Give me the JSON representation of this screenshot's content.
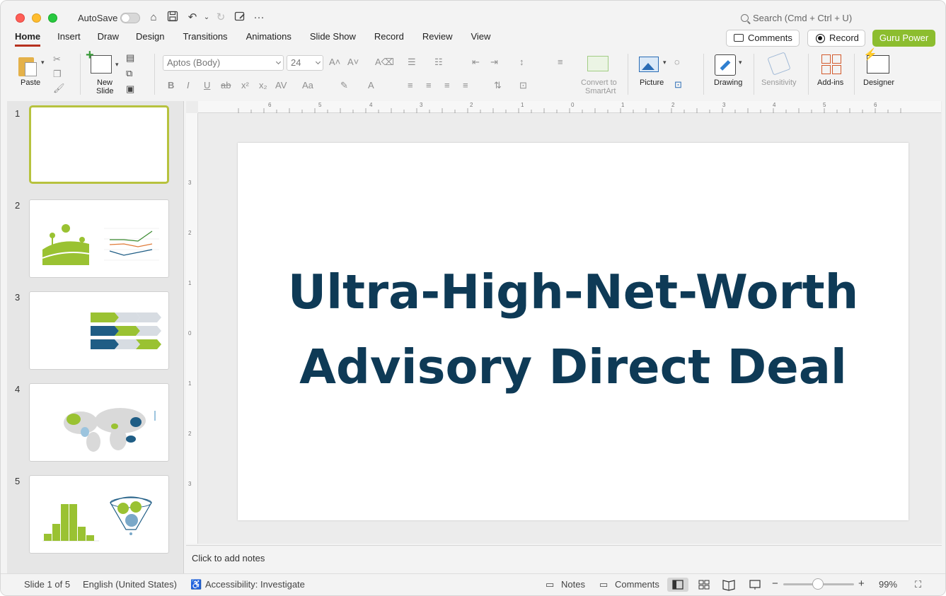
{
  "titlebar": {
    "autosave_label": "AutoSave",
    "search_placeholder": "Search (Cmd + Ctrl + U)"
  },
  "tabs": [
    {
      "label": "Home",
      "active": true
    },
    {
      "label": "Insert"
    },
    {
      "label": "Draw"
    },
    {
      "label": "Design"
    },
    {
      "label": "Transitions"
    },
    {
      "label": "Animations"
    },
    {
      "label": "Slide Show"
    },
    {
      "label": "Record"
    },
    {
      "label": "Review"
    },
    {
      "label": "View"
    }
  ],
  "header_buttons": {
    "comments": "Comments",
    "record": "Record",
    "guru": "Guru Power"
  },
  "ribbon": {
    "paste": "Paste",
    "new_slide_line1": "New",
    "new_slide_line2": "Slide",
    "font_name": "Aptos (Body)",
    "font_size": "24",
    "convert_line1": "Convert to",
    "convert_line2": "SmartArt",
    "picture": "Picture",
    "drawing": "Drawing",
    "sensitivity": "Sensitivity",
    "addins": "Add-ins",
    "designer": "Designer"
  },
  "thumbnails": [
    {
      "number": "1",
      "selected": true
    },
    {
      "number": "2"
    },
    {
      "number": "3"
    },
    {
      "number": "4"
    },
    {
      "number": "5"
    }
  ],
  "ruler": {
    "top_ticks": [
      "6",
      "5",
      "4",
      "3",
      "2",
      "1",
      "0",
      "1",
      "2",
      "3",
      "4",
      "5",
      "6"
    ],
    "left_ticks": [
      "3",
      "2",
      "1",
      "0",
      "1",
      "2",
      "3"
    ]
  },
  "slide": {
    "title_line1": "Ultra-High-Net-Worth",
    "title_line2": "Advisory Direct Deal",
    "title_color": "#0e3a56"
  },
  "notes": {
    "placeholder": "Click to add notes"
  },
  "status": {
    "slide_info": "Slide 1 of 5",
    "language": "English (United States)",
    "accessibility": "Accessibility: Investigate",
    "notes": "Notes",
    "comments": "Comments",
    "zoom": "99%",
    "zoom_fraction": 0.5
  },
  "colors": {
    "accent_green": "#8cbd2f",
    "tab_underline": "#b7311f"
  }
}
